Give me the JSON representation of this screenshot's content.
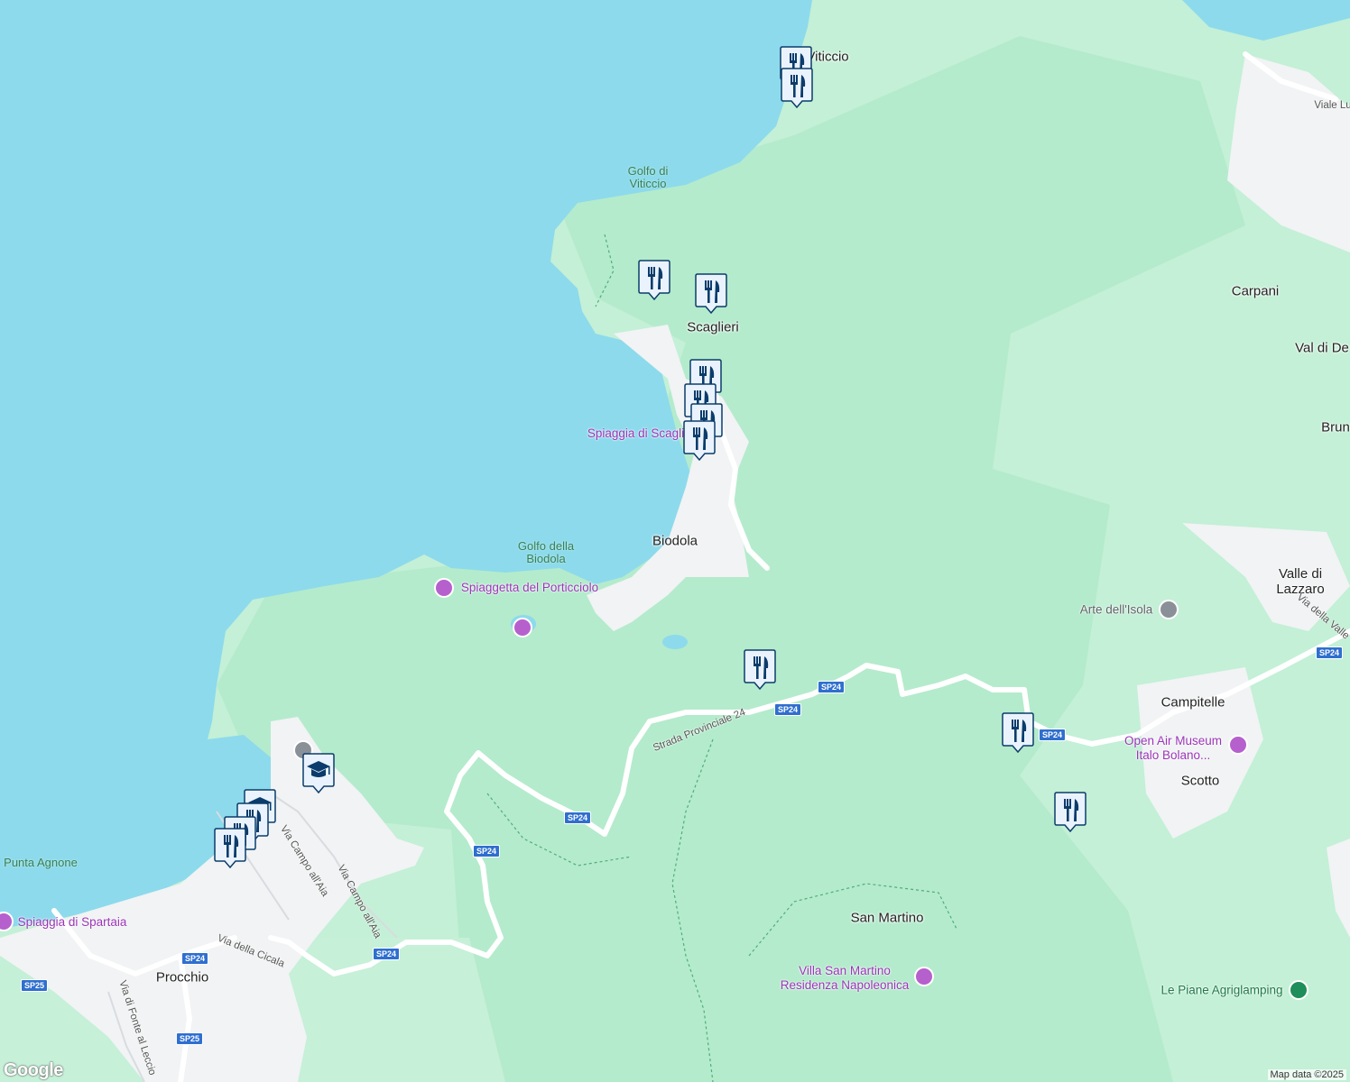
{
  "colors": {
    "sea": "#8ddaec",
    "land": "#c3f0d6",
    "forest": "#b4ebcc",
    "urban": "#f1f3f4",
    "road": "#ffffff",
    "marker": "#0b3c6b",
    "poi": "#a142f4"
  },
  "labels": {
    "viticcio": "Viticcio",
    "golfo_viticcio": "Golfo di Viticcio",
    "scaglieri": "Scaglieri",
    "spiaggia_scaglieri": "Spiaggia di Scaglieri",
    "biodola": "Biodola",
    "golfo_biodola": "Golfo della Biodola",
    "spiaggetta": "Spiaggetta del Porticciolo",
    "carpani": "Carpani",
    "val_di": "Val di De",
    "brun": "Brun",
    "valle_lazzaro": "Valle di Lazzaro",
    "arte_isola": "Arte dell'Isola",
    "campitelle": "Campitelle",
    "open_air": "Open Air Museum Italo Bolano...",
    "scotto": "Scotto",
    "san_martino": "San Martino",
    "villa_san_martino": "Villa San Martino Residenza Napoleonica",
    "le_piane": "Le Piane Agriglamping",
    "punta_agnone": "Punta Agnone",
    "spiaggia_spartaia": "Spiaggia di Spartaia",
    "procchio": "Procchio",
    "viale_lu": "Viale Lu",
    "via_della_valle": "Via della Valle",
    "strada_prov": "Strada Provinciale 24",
    "via_campo_1": "Via Campo all'Aia",
    "via_campo_2": "Via Campo all'Aia",
    "via_cicala": "Via della Cicala",
    "via_fonte": "Via di Fonte al Leccio"
  },
  "shields": [
    "SP24",
    "SP24",
    "SP24",
    "SP24",
    "SP24",
    "SP24",
    "SP24",
    "SP25",
    "SP25",
    "SP24"
  ],
  "attribution": "Map data ©2025",
  "logo": "Google",
  "markers": [
    "restaurant-marker",
    "school-marker"
  ]
}
